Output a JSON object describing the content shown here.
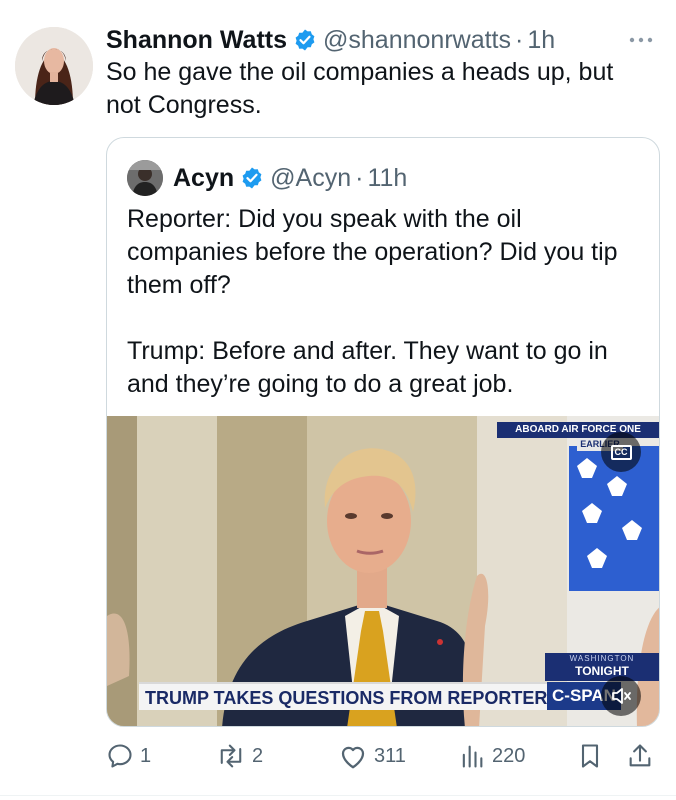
{
  "tweet": {
    "author_name": "Shannon Watts",
    "author_handle": "@shannonrwatts",
    "separator": "·",
    "time": "1h",
    "text": "So he gave the oil companies a heads up, but not Congress."
  },
  "quoted_tweet": {
    "author_name": "Acyn",
    "author_handle": "@Acyn",
    "separator": "·",
    "time": "11h",
    "paragraphs": [
      "Reporter: Did you speak with the oil companies before the operation? Did you tip them off?",
      "Trump: Before and after. They want to go in and they’re going to do a great job."
    ],
    "video": {
      "top_banner": "ABOARD AIR FORCE ONE",
      "earlier_tag": "EARLIER",
      "location_line1": "WASHINGTON",
      "location_line2": "TONIGHT",
      "chyron": "TRUMP TAKES QUESTIONS FROM REPORTERS",
      "network": "C-SPAN",
      "cc_label": "CC"
    }
  },
  "actions": {
    "replies": "1",
    "reposts": "2",
    "likes": "311",
    "views": "220"
  },
  "colors": {
    "verified_blue": "#1d9bf0",
    "muted_text": "#536471",
    "border": "#cfd9de",
    "chyron_text": "#1a2a66",
    "cspan_blue": "#1c3a8a"
  },
  "icons": [
    "verified-badge-icon",
    "more-dots-icon",
    "reply-icon",
    "repost-icon",
    "like-icon",
    "views-icon",
    "bookmark-icon",
    "share-icon",
    "closed-captions-icon",
    "mute-icon"
  ]
}
